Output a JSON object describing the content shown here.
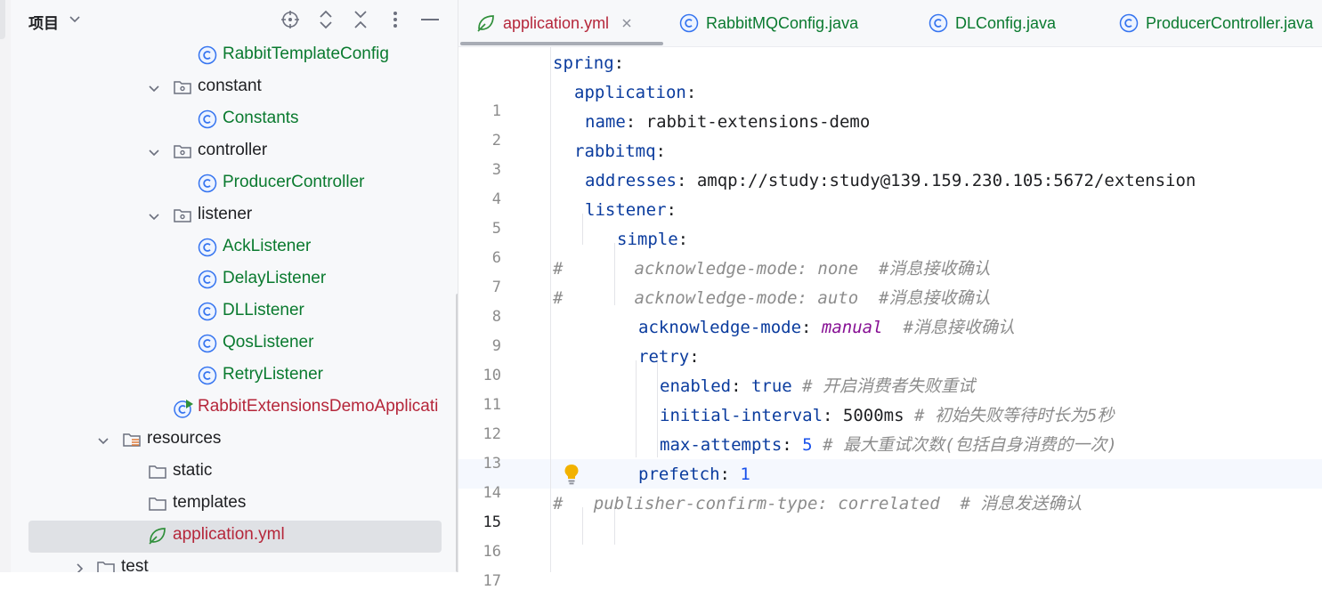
{
  "project_panel": {
    "title": "项目",
    "header_icons": [
      "crosshair-icon",
      "expand-icon",
      "collapse-icon",
      "more-icon",
      "minimize-icon"
    ],
    "tree": [
      {
        "label": "RabbitTemplateConfig",
        "kind": "class"
      },
      {
        "label": "constant",
        "kind": "package",
        "expanded": true
      },
      {
        "label": "Constants",
        "kind": "class"
      },
      {
        "label": "controller",
        "kind": "package",
        "expanded": true
      },
      {
        "label": "ProducerController",
        "kind": "class"
      },
      {
        "label": "listener",
        "kind": "package",
        "expanded": true
      },
      {
        "label": "AckListener",
        "kind": "class"
      },
      {
        "label": "DelayListener",
        "kind": "class"
      },
      {
        "label": "DLListener",
        "kind": "class"
      },
      {
        "label": "QosListener",
        "kind": "class"
      },
      {
        "label": "RetryListener",
        "kind": "class"
      },
      {
        "label": "RabbitExtensionsDemoApplicati",
        "kind": "spring-app"
      },
      {
        "label": "resources",
        "kind": "resources",
        "expanded": true
      },
      {
        "label": "static",
        "kind": "folder"
      },
      {
        "label": "templates",
        "kind": "folder"
      },
      {
        "label": "application.yml",
        "kind": "yml",
        "selected": true
      },
      {
        "label": "test",
        "kind": "folder",
        "expanded": false
      }
    ]
  },
  "tabs": [
    {
      "label": "application.yml",
      "icon": "spring-yml-icon",
      "active": true
    },
    {
      "label": "RabbitMQConfig.java",
      "icon": "class-icon"
    },
    {
      "label": "DLConfig.java",
      "icon": "class-icon"
    },
    {
      "label": "ProducerController.java",
      "icon": "class-icon"
    }
  ],
  "editor": {
    "current_line": 15,
    "line_numbers": [
      "1",
      "2",
      "3",
      "4",
      "5",
      "6",
      "7",
      "8",
      "9",
      "10",
      "11",
      "12",
      "13",
      "14",
      "15",
      "16",
      "17"
    ],
    "lines": [
      {
        "n": 1,
        "tokens": [
          [
            "k",
            "spring"
          ],
          [
            "p",
            ":"
          ]
        ]
      },
      {
        "n": 2,
        "tokens": [
          [
            "k",
            "application"
          ],
          [
            "p",
            ":"
          ]
        ]
      },
      {
        "n": 3,
        "tokens": [
          [
            "k",
            "name"
          ],
          [
            "p",
            ": "
          ],
          [
            "v",
            "rabbit-extensions-demo"
          ]
        ]
      },
      {
        "n": 4,
        "tokens": [
          [
            "k",
            "rabbitmq"
          ],
          [
            "p",
            ":"
          ]
        ]
      },
      {
        "n": 5,
        "tokens": [
          [
            "k",
            "addresses"
          ],
          [
            "p",
            ": "
          ],
          [
            "v",
            "amqp://study:study@139.159.230.105:5672/extension"
          ]
        ]
      },
      {
        "n": 6,
        "tokens": [
          [
            "k",
            "listener"
          ],
          [
            "p",
            ":"
          ]
        ]
      },
      {
        "n": 7,
        "tokens": [
          [
            "k",
            "simple"
          ],
          [
            "p",
            ":"
          ]
        ]
      },
      {
        "n": 8,
        "tokens": [
          [
            "c",
            "#       acknowledge-mode: none  #消息接收确认"
          ]
        ]
      },
      {
        "n": 9,
        "tokens": [
          [
            "c",
            "#       acknowledge-mode: auto  #消息接收确认"
          ]
        ]
      },
      {
        "n": 10,
        "tokens": [
          [
            "k",
            "acknowledge-mode"
          ],
          [
            "p",
            ": "
          ],
          [
            "en",
            "manual"
          ],
          [
            "c",
            "  #消息接收确认"
          ]
        ]
      },
      {
        "n": 11,
        "tokens": [
          [
            "k",
            "retry"
          ],
          [
            "p",
            ":"
          ]
        ]
      },
      {
        "n": 12,
        "tokens": [
          [
            "k",
            "enabled"
          ],
          [
            "p",
            ": "
          ],
          [
            "kw",
            "true"
          ],
          [
            "c",
            " # 开启消费者失败重试"
          ]
        ]
      },
      {
        "n": 13,
        "tokens": [
          [
            "k",
            "initial-interval"
          ],
          [
            "p",
            ": "
          ],
          [
            "v",
            "5000ms"
          ],
          [
            "c",
            " # 初始失败等待时长为5秒"
          ]
        ]
      },
      {
        "n": 14,
        "tokens": [
          [
            "k",
            "max-attempts"
          ],
          [
            "p",
            ": "
          ],
          [
            "num",
            "5"
          ],
          [
            "c",
            " # 最大重试次数(包括自身消费的一次)"
          ]
        ]
      },
      {
        "n": 15,
        "tokens": [
          [
            "k",
            "prefetch"
          ],
          [
            "p",
            ": "
          ],
          [
            "num",
            "1"
          ]
        ]
      },
      {
        "n": 16,
        "tokens": [
          [
            "c",
            "#   publisher-confirm-type: correlated  # 消息发送确认"
          ]
        ]
      },
      {
        "n": 17,
        "tokens": []
      }
    ]
  },
  "colors": {
    "class_name": "#0a7a2f",
    "spring_file": "#b5263a",
    "yaml_key": "#0b3c9e",
    "comment": "#8c8c8c",
    "enum_value": "#871094",
    "number": "#1750eb"
  }
}
